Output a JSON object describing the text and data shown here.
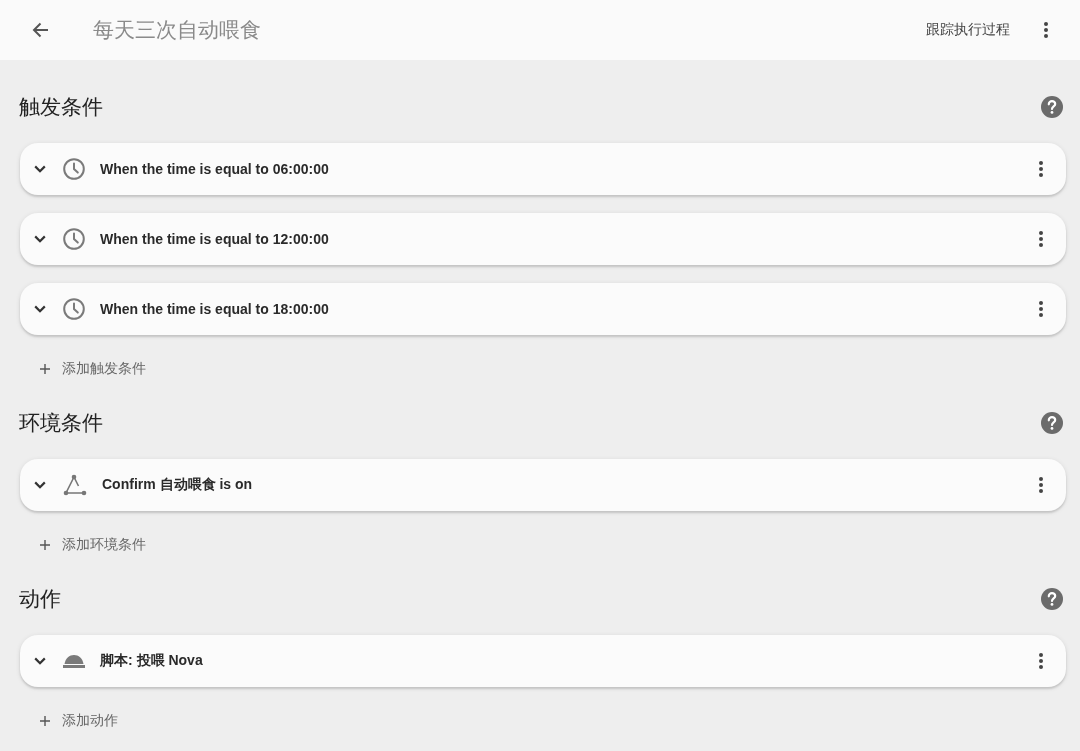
{
  "header": {
    "title": "每天三次自动喂食",
    "trace_button": "跟踪执行过程"
  },
  "sections": [
    {
      "heading": "触发条件",
      "items": [
        {
          "kind": "time",
          "text": "When the time is equal to 06:00:00",
          "expanded": false
        },
        {
          "kind": "time",
          "text": "When the time is equal to 12:00:00",
          "expanded": false
        },
        {
          "kind": "time",
          "text": "When the time is equal to 18:00:00",
          "expanded": false
        }
      ],
      "add_button": "添加触发条件"
    },
    {
      "heading": "环境条件",
      "items": [
        {
          "kind": "state",
          "text": "Confirm 自动喂食 is on",
          "expanded": false
        }
      ],
      "add_button": "添加环境条件"
    },
    {
      "heading": "动作",
      "items": [
        {
          "kind": "script",
          "text": "脚本: 投喂 Nova",
          "expanded": false
        }
      ],
      "add_button": "添加动作"
    }
  ]
}
